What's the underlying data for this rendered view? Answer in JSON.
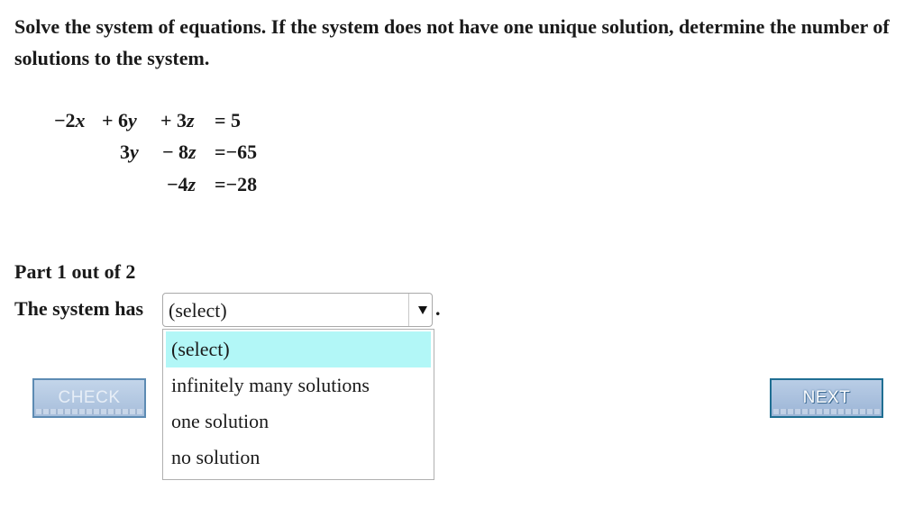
{
  "question": {
    "text": "Solve the system of equations. If the system does not have one unique solution, determine the number of solutions to the system."
  },
  "equations": [
    {
      "x": "−2x",
      "y": "+ 6y",
      "z": "+ 3z",
      "rhs": "= 5"
    },
    {
      "x": "",
      "y": "3y",
      "z": "− 8z",
      "rhs": "=−65"
    },
    {
      "x": "",
      "y": "",
      "z": "−4z",
      "rhs": "=−28"
    }
  ],
  "part": {
    "label": "Part 1 out of 2"
  },
  "answer": {
    "prompt": "The system has",
    "selected": "(select)",
    "end_punct": ".",
    "options": [
      "(select)",
      "infinitely many solutions",
      "one solution",
      "no solution"
    ],
    "highlighted_index": 0,
    "highlight_color": "#b2f7f7"
  },
  "buttons": {
    "check": "CHECK",
    "next": "NEXT"
  }
}
